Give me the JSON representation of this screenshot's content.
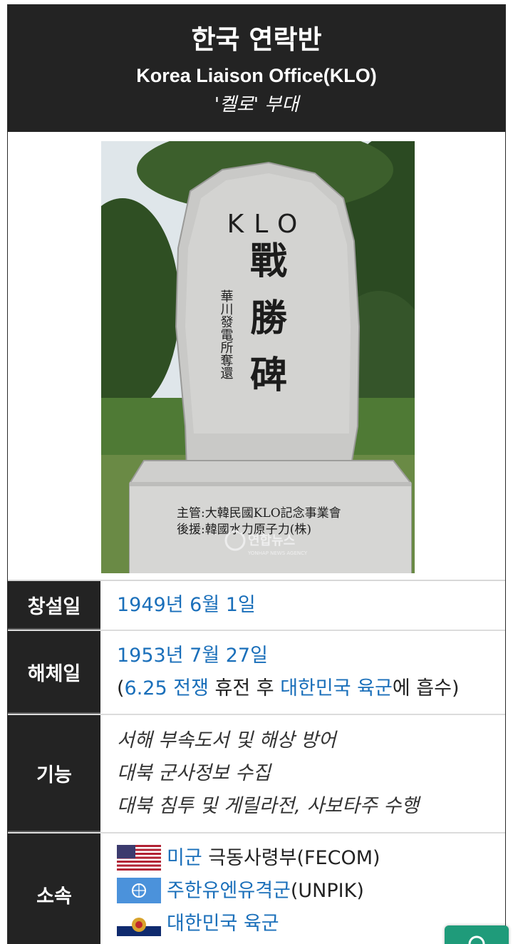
{
  "infobox": {
    "title": "한국 연락반",
    "subtitle": "Korea Liaison Office(KLO)",
    "alias": "'켈로' 부대"
  },
  "photo": {
    "stone_top": "KLO",
    "stone_main": [
      "戰",
      "勝",
      "碑"
    ],
    "stone_side": "華川發電所奪還",
    "plaque_line1": "主管:大韓民國KLO記念事業會",
    "plaque_line2": "後援:韓國水力原子力(株)",
    "watermark": "연합뉴스",
    "watermark_sub": "YONHAP NEWS AGENCY"
  },
  "rows": {
    "founded": {
      "label": "창설일",
      "value": "1949년 6월 1일"
    },
    "dissolved": {
      "label": "해체일",
      "value": "1953년 7월 27일",
      "note_open": "(",
      "note_link1": "6.25 전쟁",
      "note_mid": " 휴전 후 ",
      "note_link2": "대한민국 육군",
      "note_end": "에 흡수)"
    },
    "function": {
      "label": "기능",
      "items": [
        "서해 부속도서 및 해상 방어",
        "대북 군사정보 수집",
        "대북 침투 및 게릴라전, 사보타주 수행"
      ]
    },
    "affiliation": {
      "label": "소속",
      "items": [
        {
          "link": "미군",
          "text": " 극동사령부(FECOM)",
          "flag": "usa-flag"
        },
        {
          "link": "주한유엔유격군",
          "text": "(UNPIK)",
          "flag": "un-flag"
        },
        {
          "link": "대한민국 육군",
          "text": "",
          "flag": "rok-army-flag"
        }
      ]
    }
  },
  "colors": {
    "header_bg": "#232323",
    "link": "#1a6fba",
    "float_button": "#1f9b7a"
  }
}
